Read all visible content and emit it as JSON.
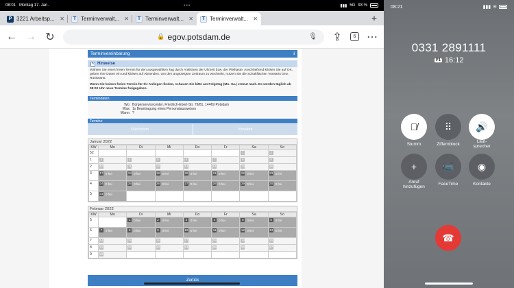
{
  "status_bar": {
    "time": "08:01",
    "date": "Montag 17. Jan.",
    "signal": "5G",
    "battery": "93 %",
    "dots": "•••"
  },
  "tabs": [
    {
      "title": "3221 Arbeitsp...",
      "favicon": "P",
      "active": false
    },
    {
      "title": "Terminverwalt...",
      "favicon": "T",
      "active": false
    },
    {
      "title": "Terminverwalt...",
      "favicon": "T",
      "active": false
    },
    {
      "title": "Terminverwalt...",
      "favicon": "T",
      "active": true
    }
  ],
  "toolbar": {
    "url": "egov.potsdam.de",
    "tab_count": "6",
    "new_tab": "+"
  },
  "page": {
    "title": "Terminvereinbarung",
    "info": "i",
    "hinweise_title": "Hinweise",
    "hint_text_1": "Wählen Sie einen freien Termin für den ausgewählten Tag durch Anklicken der Uhrzeit bzw. der Pfeiltaste. Anschließend klicken Sie auf OK, geben Ihre Daten ein und klicken auf Absenden. Um den angezeigten Zeitraum zu wechseln, nutzen Sie die Schaltflächen Vorwärts bzw. Rückwärts.",
    "hint_text_2": "Wenn Sie keinen freien Termin für Ihr Anliegen finden, schauen Sie bitte am Folgetag (Mo. Sa.) erneut nach. Es werden täglich ab 08:00 Uhr neue Termine freigegeben.",
    "termindaten_title": "Termindaten",
    "wo_label": "Wo:",
    "wo_value": "Bürgerservicecenter, Friedrich-Ebert-Str. 79/81, 14469 Potsdam",
    "was_label": "Was:",
    "was_value": "1x Beantragung eines Personalausweises",
    "wann_label": "Wann:",
    "wann_value": "?",
    "termine_title": "Termine",
    "back_label": "Rückwärts",
    "forward_label": "Vorwärts",
    "kw_label": "KW",
    "weekdays": [
      "Mo",
      "Di",
      "Mi",
      "Do",
      "Fr",
      "Sa",
      "So"
    ],
    "free_label": "0 frei",
    "zurueck_label": "Zurück"
  },
  "calendar": [
    {
      "name": "Januar 2022",
      "weeks": [
        {
          "kw": "52",
          "days": [
            null,
            null,
            null,
            null,
            null,
            {
              "d": "1",
              "active": false
            },
            {
              "d": "2",
              "active": false
            }
          ]
        },
        {
          "kw": "1",
          "days": [
            {
              "d": "3",
              "active": false
            },
            {
              "d": "4",
              "active": false
            },
            {
              "d": "5",
              "active": false
            },
            {
              "d": "6",
              "active": false
            },
            {
              "d": "7",
              "active": false
            },
            {
              "d": "8",
              "active": false
            },
            {
              "d": "9",
              "active": false
            }
          ]
        },
        {
          "kw": "2",
          "days": [
            {
              "d": "10",
              "active": false
            },
            {
              "d": "11",
              "active": false
            },
            {
              "d": "12",
              "active": false
            },
            {
              "d": "13",
              "active": false
            },
            {
              "d": "14",
              "active": false
            },
            {
              "d": "15",
              "active": false
            },
            {
              "d": "16",
              "active": false
            }
          ]
        },
        {
          "kw": "3",
          "days": [
            {
              "d": "17",
              "active": true
            },
            {
              "d": "18",
              "active": true
            },
            {
              "d": "19",
              "active": true
            },
            {
              "d": "20",
              "active": true
            },
            {
              "d": "21",
              "active": true
            },
            {
              "d": "22",
              "active": true
            },
            {
              "d": "23",
              "active": true
            }
          ]
        },
        {
          "kw": "4",
          "days": [
            {
              "d": "24",
              "active": true
            },
            {
              "d": "25",
              "active": true
            },
            {
              "d": "26",
              "active": true
            },
            {
              "d": "27",
              "active": true
            },
            {
              "d": "28",
              "active": true
            },
            {
              "d": "29",
              "active": true
            },
            {
              "d": "30",
              "active": true
            }
          ]
        },
        {
          "kw": "5",
          "days": [
            {
              "d": "31",
              "active": true
            },
            null,
            null,
            null,
            null,
            null,
            null
          ]
        }
      ]
    },
    {
      "name": "Februar 2022",
      "weeks": [
        {
          "kw": "5",
          "days": [
            null,
            {
              "d": "1",
              "active": true
            },
            {
              "d": "2",
              "active": true
            },
            {
              "d": "3",
              "active": true
            },
            {
              "d": "4",
              "active": true
            },
            {
              "d": "5",
              "active": true
            },
            {
              "d": "6",
              "active": true
            }
          ]
        },
        {
          "kw": "6",
          "days": [
            {
              "d": "7",
              "active": true
            },
            {
              "d": "8",
              "active": true
            },
            {
              "d": "9",
              "active": true
            },
            {
              "d": "10",
              "active": true
            },
            {
              "d": "11",
              "active": true
            },
            {
              "d": "12",
              "active": true
            },
            {
              "d": "13",
              "active": true
            }
          ]
        },
        {
          "kw": "7",
          "days": [
            {
              "d": "14",
              "active": false
            },
            {
              "d": "15",
              "active": false
            },
            {
              "d": "16",
              "active": false
            },
            {
              "d": "17",
              "active": false
            },
            {
              "d": "18",
              "active": false
            },
            {
              "d": "19",
              "active": false
            },
            {
              "d": "20",
              "active": false
            }
          ]
        },
        {
          "kw": "8",
          "days": [
            {
              "d": "21",
              "active": false
            },
            {
              "d": "22",
              "active": false
            },
            {
              "d": "23",
              "active": false
            },
            {
              "d": "24",
              "active": false
            },
            {
              "d": "25",
              "active": false
            },
            {
              "d": "26",
              "active": false
            },
            {
              "d": "27",
              "active": false
            }
          ]
        },
        {
          "kw": "9",
          "days": [
            {
              "d": "28",
              "active": false
            },
            null,
            null,
            null,
            null,
            null,
            null
          ]
        }
      ]
    }
  ],
  "phone": {
    "time": "08:21",
    "number": "0331 2891111",
    "sim": "P1",
    "duration": "16:12",
    "buttons": [
      {
        "label": "Stumm",
        "icon": "mic-off-icon",
        "style": "white"
      },
      {
        "label": "Ziffernblock",
        "icon": "keypad-icon",
        "style": "grey"
      },
      {
        "label": "Laut-\nsprecher",
        "icon": "speaker-icon",
        "style": "white"
      },
      {
        "label": "Anruf\nhinzufügen",
        "icon": "plus-icon",
        "style": "grey"
      },
      {
        "label": "FaceTime",
        "icon": "facetime-icon",
        "style": "grey"
      },
      {
        "label": "Kontakte",
        "icon": "contacts-icon",
        "style": "grey"
      }
    ],
    "end_call": "end-call-icon"
  }
}
